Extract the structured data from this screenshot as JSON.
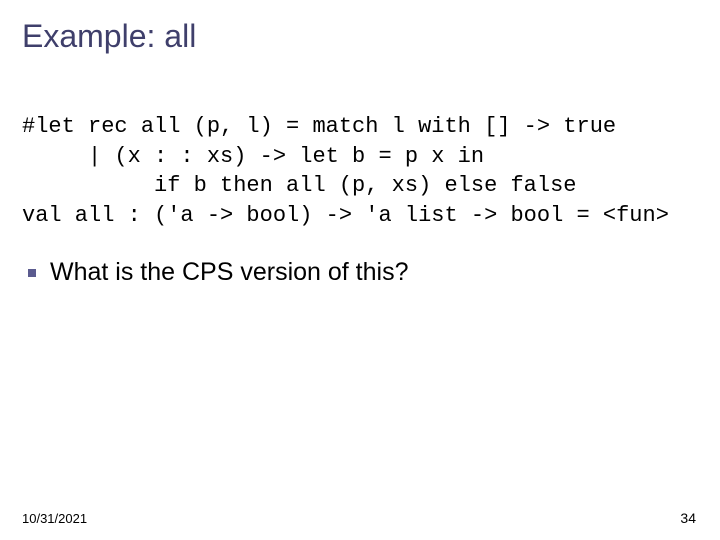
{
  "title": "Example: all",
  "code": {
    "line1": "#let rec all (p, l) = match l with [] -> true",
    "line2": "     | (x : : xs) -> let b = p x in",
    "line3": "          if b then all (p, xs) else false",
    "line4": "val all : ('a -> bool) -> 'a list -> bool = <fun>"
  },
  "question": "What is the CPS version of this?",
  "footer": {
    "date": "10/31/2021",
    "page": "34"
  }
}
